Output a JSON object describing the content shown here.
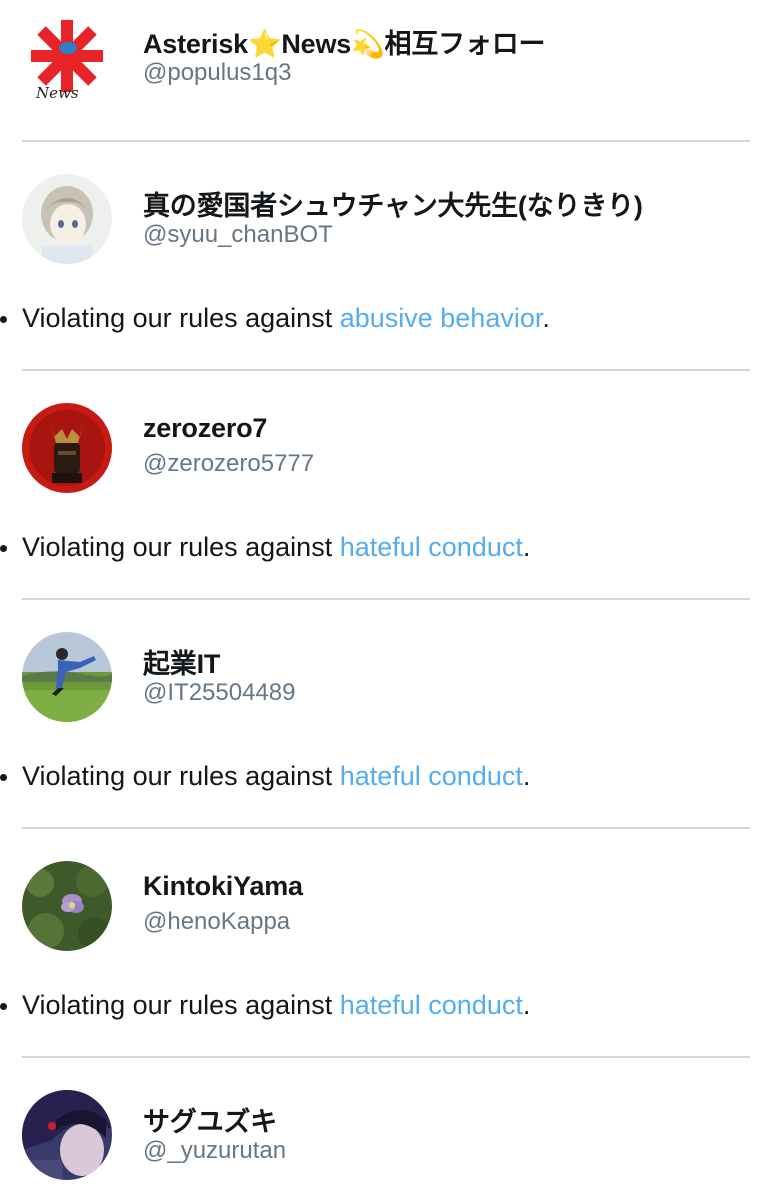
{
  "accounts": [
    {
      "name": "Asterisk⭐News💫相互フォロー",
      "handle": "@populus1q3",
      "avatar_icon": "asterisk-news-logo"
    },
    {
      "name": "真の愛国者シュウチャン大先生(なりきり)",
      "handle": "@syuu_chanBOT",
      "avatar_icon": "anime-girl-avatar",
      "reason": {
        "prefix": "Violating our rules against ",
        "link": "abusive behavior",
        "suffix": "."
      }
    },
    {
      "name": "zerozero7",
      "handle": "@zerozero5777",
      "avatar_icon": "samurai-helmet-avatar",
      "reason": {
        "prefix": "Violating our rules against ",
        "link": "hateful conduct",
        "suffix": "."
      }
    },
    {
      "name": "起業IT",
      "handle": "@IT25504489",
      "avatar_icon": "jumping-person-avatar",
      "reason": {
        "prefix": "Violating our rules against ",
        "link": "hateful conduct",
        "suffix": "."
      }
    },
    {
      "name": "KintokiYama",
      "handle": "@henoKappa",
      "avatar_icon": "purple-flower-avatar",
      "reason": {
        "prefix": "Violating our rules against ",
        "link": "hateful conduct",
        "suffix": "."
      }
    },
    {
      "name": "サグユズキ",
      "handle": "@_yuzurutan",
      "avatar_icon": "dark-anime-avatar"
    }
  ],
  "colors": {
    "link": "#55acee",
    "handle": "#657786",
    "divider": "#d6d6d6",
    "text": "#14171a"
  }
}
